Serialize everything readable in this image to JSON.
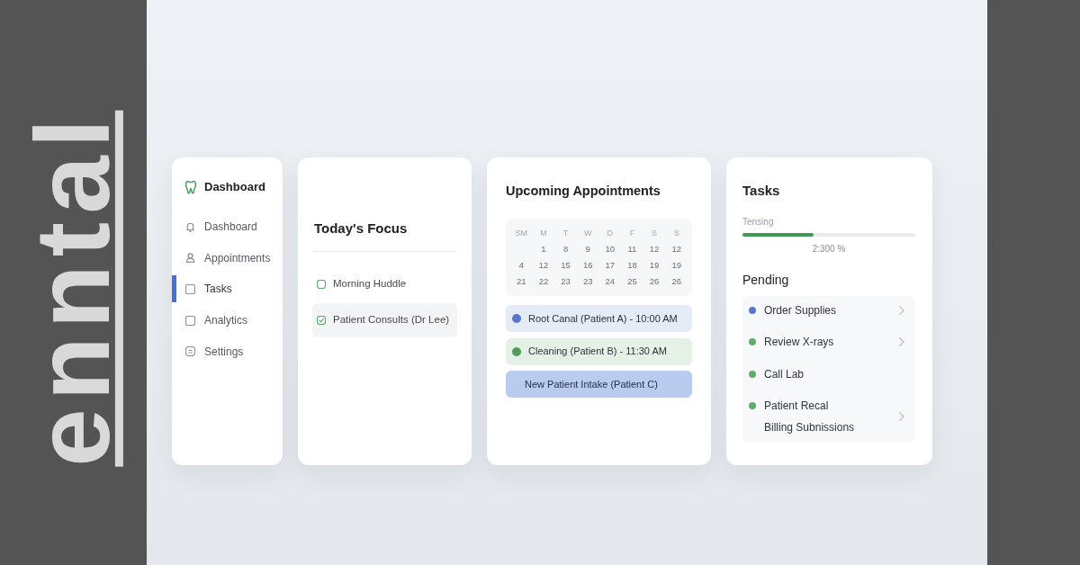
{
  "logo": {
    "text": "enntal"
  },
  "sidebar": {
    "brand": "Dashboard",
    "items": [
      {
        "label": "Dashboard",
        "selected": false
      },
      {
        "label": "Appointments",
        "selected": false
      },
      {
        "label": "Tasks",
        "selected": true
      },
      {
        "label": "Analytics",
        "selected": false
      },
      {
        "label": "Settings",
        "selected": false
      }
    ]
  },
  "focus": {
    "title": "Today's Focus",
    "items": [
      {
        "label": "Morning Huddle",
        "checked": false
      },
      {
        "label": "Patient Consults (Dr Lee)",
        "checked": true
      }
    ]
  },
  "appointments": {
    "title": "Upcoming Appointments",
    "calendar": {
      "weekdays": [
        "SM",
        "M",
        "T",
        "W",
        "D",
        "F",
        "S",
        "S"
      ],
      "weeks": [
        [
          "1",
          "8",
          "9",
          "10",
          "11",
          "12",
          "12"
        ],
        [
          "4",
          "12",
          "15",
          "16",
          "17",
          "18",
          "19",
          "19"
        ],
        [
          "21",
          "22",
          "23",
          "23",
          "24",
          "25",
          "26",
          "26"
        ]
      ]
    },
    "items": [
      {
        "label": "Root Canal (Patient A) - 10:00 AM",
        "kind": "dot",
        "color": "#5876cf"
      },
      {
        "label": "Cleaning (Patient B) - 11:30 AM",
        "kind": "dot",
        "color": "#4f9d5a"
      },
      {
        "label": "New Patient Intake (Patient C)",
        "kind": "block",
        "color": "#b9ccf0"
      }
    ]
  },
  "tasks": {
    "title": "Tasks",
    "progress": {
      "label": "Tensing",
      "level": 0.41,
      "reading": "2:300 %"
    },
    "pending": {
      "title": "Pending",
      "items": [
        {
          "label": "Order Supplies",
          "color": "#5a78cc",
          "expandable": true
        },
        {
          "label": "Review X-rays",
          "color": "#63ab6a",
          "expandable": true
        },
        {
          "label": "Call Lab",
          "color": "#63ab6a",
          "expandable": false
        },
        {
          "label": "Patient Recal",
          "detail": "Billing Subnissions",
          "color": "#63ab6a",
          "expandable": true
        }
      ]
    }
  }
}
